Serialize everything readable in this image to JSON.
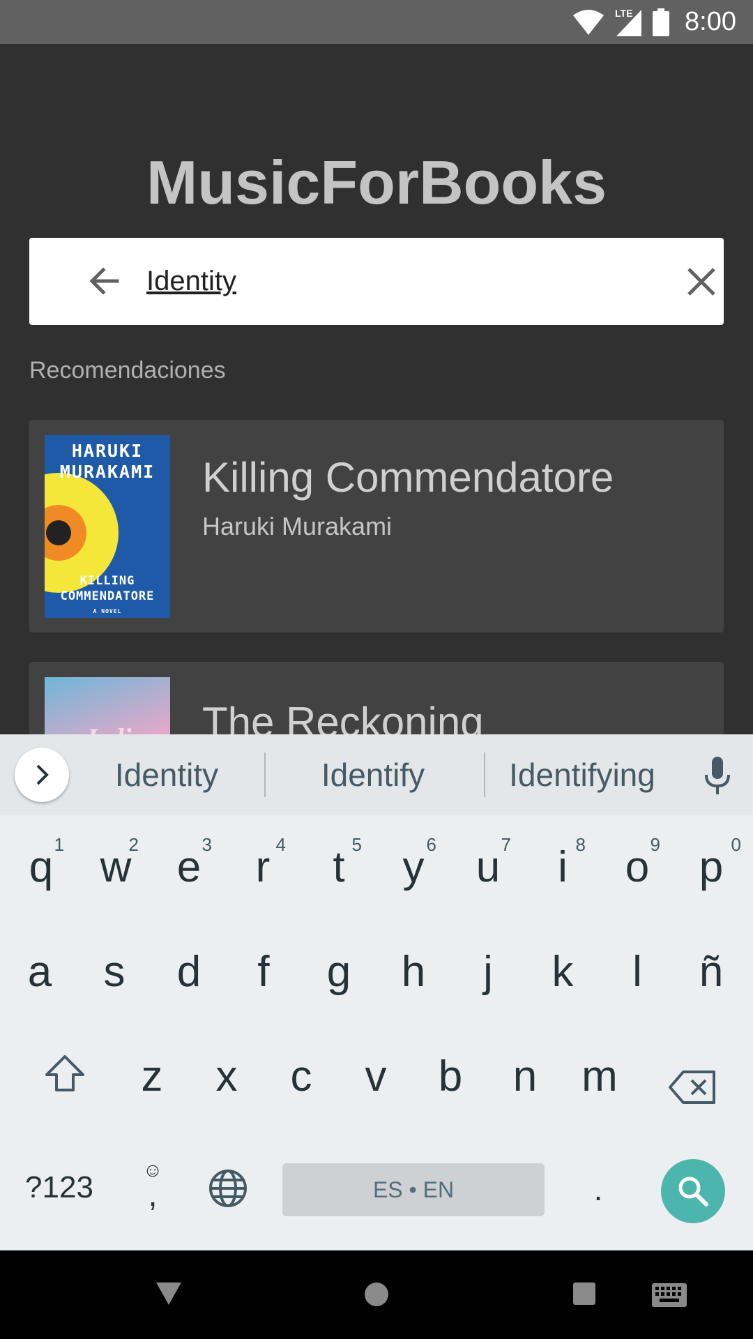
{
  "status_bar": {
    "time": "8:00",
    "network": "LTE",
    "icons": [
      "wifi-icon",
      "signal-icon",
      "battery-icon"
    ]
  },
  "app": {
    "title": "MusicForBooks"
  },
  "search": {
    "value": "Identity",
    "back_icon": "arrow-back-icon",
    "clear_icon": "close-icon"
  },
  "recommendations": {
    "label": "Recomendaciones",
    "items": [
      {
        "title": "Killing Commendatore",
        "author": "Haruki Murakami",
        "cover_lines_top": [
          "HARUKI",
          "MURAKAMI"
        ],
        "cover_lines_bottom": [
          "KILLING",
          "COMMENDATORE"
        ],
        "cover_tagline": "A NOVEL"
      },
      {
        "title": "The Reckoning",
        "author": "",
        "cover_text": "Jedi"
      }
    ]
  },
  "keyboard": {
    "suggestions": [
      "Identity",
      "Identify",
      "Identifying"
    ],
    "row1": [
      {
        "key": "q",
        "num": "1"
      },
      {
        "key": "w",
        "num": "2"
      },
      {
        "key": "e",
        "num": "3"
      },
      {
        "key": "r",
        "num": "4"
      },
      {
        "key": "t",
        "num": "5"
      },
      {
        "key": "y",
        "num": "6"
      },
      {
        "key": "u",
        "num": "7"
      },
      {
        "key": "i",
        "num": "8"
      },
      {
        "key": "o",
        "num": "9"
      },
      {
        "key": "p",
        "num": "0"
      }
    ],
    "row2": [
      "a",
      "s",
      "d",
      "f",
      "g",
      "h",
      "j",
      "k",
      "l",
      "ñ"
    ],
    "row3": [
      "z",
      "x",
      "c",
      "v",
      "b",
      "n",
      "m"
    ],
    "symbols_key": "?123",
    "comma_key": ",",
    "emoji_glyph": "☺",
    "space_label": "ES • EN",
    "period_key": ".",
    "colors": {
      "accent": "#4db6ac",
      "background": "#eceff1"
    }
  },
  "nav_bar": {
    "icons": [
      "back-triangle-icon",
      "home-circle-icon",
      "recents-square-icon",
      "keyboard-switch-icon"
    ]
  }
}
